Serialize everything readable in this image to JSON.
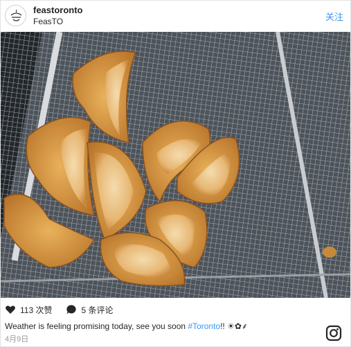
{
  "header": {
    "username": "feastoronto",
    "display_name": "FeasTO",
    "follow_label": "关注"
  },
  "photo": {
    "icon": "dumplings-photo"
  },
  "stats": {
    "likes_label": "113 次赞",
    "comments_label": "5 条评论"
  },
  "caption": {
    "text_before": "Weather is feeling promising today, see you soon ",
    "hashtag": "#Toronto",
    "text_after": "!! ☀✿⸙"
  },
  "date": "4月9日",
  "colors": {
    "link": "#3897f0",
    "text": "#262626",
    "muted": "#999999"
  }
}
